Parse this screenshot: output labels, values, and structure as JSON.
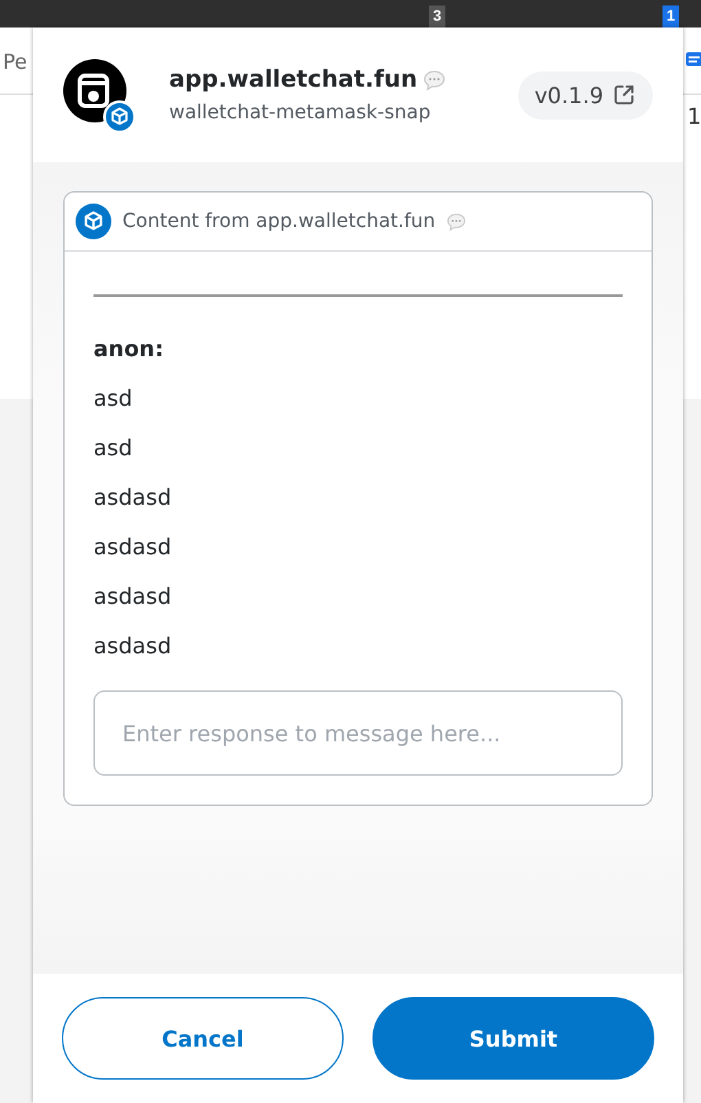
{
  "background": {
    "tab_badges": [
      "3",
      "1"
    ],
    "left_text": "Pe",
    "right_text": "1"
  },
  "header": {
    "title": "app.walletchat.fun",
    "subtitle": "walletchat-metamask-snap",
    "version": "v0.1.9"
  },
  "content": {
    "heading": "Content from app.walletchat.fun",
    "messages": [
      {
        "kind": "sender",
        "text": "anon:"
      },
      {
        "kind": "line",
        "text": "asd"
      },
      {
        "kind": "line",
        "text": "asd"
      },
      {
        "kind": "line",
        "text": "asdasd"
      },
      {
        "kind": "line",
        "text": "asdasd"
      },
      {
        "kind": "line",
        "text": "asdasd"
      },
      {
        "kind": "line",
        "text": "asdasd"
      }
    ],
    "response": {
      "placeholder": "Enter response to message here..."
    }
  },
  "buttons": [
    {
      "kind": "secondary",
      "label": "Cancel"
    },
    {
      "kind": "primary",
      "label": "Submit"
    }
  ]
}
